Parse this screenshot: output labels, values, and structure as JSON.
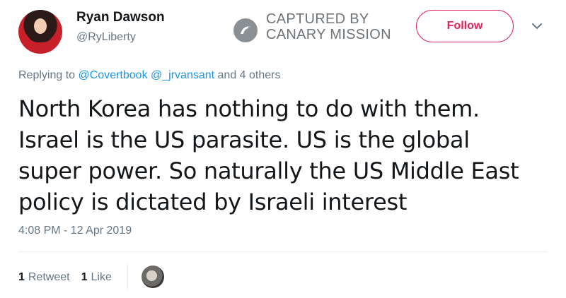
{
  "tweet": {
    "author_name": "Ryan Dawson",
    "author_handle": "@RyLiberty",
    "follow_label": "Follow",
    "reply_prefix": "Replying to",
    "reply_mention_1": "@Covertbook",
    "reply_mention_2": "@_jrvansant",
    "reply_suffix": "and 4 others",
    "text_line_1": "North Korea has nothing to do with them.",
    "text_line_2": "Israel is the US parasite. US is the global",
    "text_line_3": "super power. So naturally the US Middle East",
    "text_line_4": "policy is dictated by Israeli interest",
    "timestamp": "4:08 PM - 12 Apr 2019",
    "retweet_count": "1",
    "retweet_label": "Retweet",
    "like_count": "1",
    "like_label": "Like"
  },
  "watermark": {
    "line_1": "CAPTURED BY",
    "line_2": "CANARY MISSION"
  },
  "colors": {
    "follow_accent": "#e0245e",
    "mention_blue": "#1b95e0",
    "secondary_text": "#657786"
  },
  "icons": {
    "more": "chevron-down-icon",
    "watermark": "canary-bird-icon"
  }
}
